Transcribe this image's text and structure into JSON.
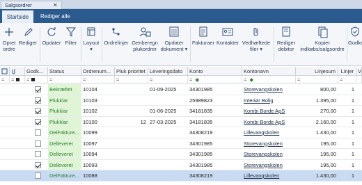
{
  "document_tab": {
    "title": "Salgsordrer",
    "close": "✕"
  },
  "ribbon_tabs": [
    {
      "label": "Startside",
      "active": true
    },
    {
      "label": "Rediger alle",
      "active": false
    }
  ],
  "ribbon": {
    "buttons": [
      {
        "icon": "plus-icon",
        "label1": "Opret",
        "label2": "ordre"
      },
      {
        "icon": "pencil-icon",
        "label1": "Rediger",
        "label2": ""
      },
      {
        "icon": "refresh-icon",
        "label1": "Opdater",
        "label2": ""
      },
      {
        "icon": "filter-icon",
        "label1": "Filter",
        "label2": ""
      },
      {
        "icon": "layout-icon",
        "label1": "Layout",
        "label2": "▾"
      },
      {
        "icon": "orderlines-icon",
        "label1": "Ordrelinjer",
        "label2": ""
      },
      {
        "icon": "regenerate-icon",
        "label1": "Genberegn",
        "label2": "plukordrer"
      },
      {
        "icon": "refresh-document-icon",
        "label1": "Opdater",
        "label2": "dokument ▾"
      },
      {
        "icon": "invoice-icon",
        "label1": "Fakturaer",
        "label2": ""
      },
      {
        "icon": "contact-card-icon",
        "label1": "Kontakter",
        "label2": ""
      },
      {
        "icon": "attachment-icon",
        "label1": "Vedhæftede",
        "label2": "filer ▾"
      },
      {
        "icon": "edit-debtor-icon",
        "label1": "Rediger",
        "label2": "debitor"
      },
      {
        "icon": "copy-icon",
        "label1": "Kopier",
        "label2": "indkøbs/salgsordre"
      },
      {
        "icon": "approve-icon",
        "label1": "Godke",
        "label2": ""
      }
    ]
  },
  "table": {
    "headers": [
      "",
      "",
      "Godk...",
      "Status",
      "Ordrenum...",
      "Pluk prioritet",
      "Leveringsdato",
      "Konto",
      "Kontonavn",
      "Linjesum",
      "Linjer",
      "Va"
    ],
    "filter_ops": [
      "=",
      "=",
      "=",
      "=",
      "=",
      "=",
      "=",
      "=",
      "=",
      "=",
      "="
    ],
    "rows": [
      {
        "approved": true,
        "status": "Bekræftet",
        "order": "10104",
        "priority": "",
        "date": "01-09-2025",
        "account": "34301985",
        "name": "Storevangskolen",
        "sum": "800,00",
        "lines": "1",
        "selected": false
      },
      {
        "approved": true,
        "status": "Plukklar",
        "order": "10103",
        "priority": "",
        "date": "",
        "account": "25989823",
        "name": "Interiør Bolig",
        "sum": "1.395,00",
        "lines": "1",
        "selected": false
      },
      {
        "approved": true,
        "status": "Plukklar",
        "order": "10102",
        "priority": "",
        "date": "01-06-2025",
        "account": "34181835",
        "name": "Kombi Borde ApS",
        "sum": "270,00",
        "lines": "1",
        "selected": false
      },
      {
        "approved": true,
        "status": "Plukklar",
        "order": "10100",
        "priority": "12",
        "date": "27-03-2025",
        "account": "34181835",
        "name": "Kombi Borde ApS",
        "sum": "2.160,00",
        "lines": "1",
        "selected": false
      },
      {
        "approved": false,
        "status": "DelFakture...",
        "order": "10099",
        "priority": "",
        "date": "",
        "account": "34308219",
        "name": "Lillevangskolen",
        "sum": "1.430,00",
        "lines": "1",
        "selected": false
      },
      {
        "approved": false,
        "status": "Delleveret",
        "order": "10097",
        "priority": "",
        "date": "",
        "account": "34301985",
        "name": "Storevangskolen",
        "sum": "195,00",
        "lines": "1",
        "selected": false
      },
      {
        "approved": false,
        "status": "Delleveret",
        "order": "10094",
        "priority": "",
        "date": "",
        "account": "34301985",
        "name": "Storevangskolen",
        "sum": "195,00",
        "lines": "1",
        "selected": false
      },
      {
        "approved": true,
        "status": "Delleveret",
        "order": "10093",
        "priority": "",
        "date": "",
        "account": "34301985",
        "name": "Storevangskolen",
        "sum": "195,00",
        "lines": "1",
        "selected": false
      },
      {
        "approved": false,
        "status": "DelFakture...",
        "order": "10088",
        "priority": "",
        "date": "",
        "account": "34308219",
        "name": "Lillevangskolen",
        "sum": "1.430,00",
        "lines": "1",
        "selected": true
      }
    ]
  },
  "colors": {
    "accent": "#2b5a8f",
    "status_green_bg": "#dff5d6",
    "status_green_text": "#2e7d32",
    "selected_row": "#c9dbf2"
  }
}
